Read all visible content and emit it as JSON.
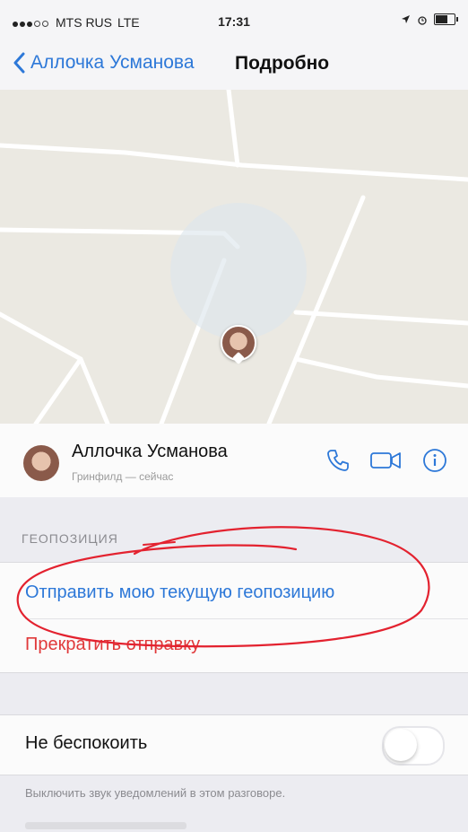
{
  "status_bar": {
    "carrier": "MTS RUS",
    "network": "LTE",
    "time": "17:31"
  },
  "nav": {
    "back_label": "Аллочка Усманова",
    "title": "Подробно"
  },
  "contact": {
    "name": "Аллочка Усманова",
    "subtitle": "Гринфилд — сейчас"
  },
  "location": {
    "section_label": "ГЕОПОЗИЦИЯ",
    "send_current": "Отправить мою текущую геопозицию",
    "stop_sending": "Прекратить отправку"
  },
  "do_not_disturb": {
    "label": "Не беспокоить",
    "enabled": false,
    "note": "Выключить звук уведомлений в этом разговоре."
  },
  "colors": {
    "link_blue": "#2d78d8",
    "destructive_red": "#e0393a",
    "annotation_red": "#e3222f"
  },
  "icons": [
    "chevron-left-icon",
    "phone-icon",
    "video-icon",
    "info-icon",
    "location-arrow-icon",
    "alarm-icon",
    "battery-icon"
  ]
}
